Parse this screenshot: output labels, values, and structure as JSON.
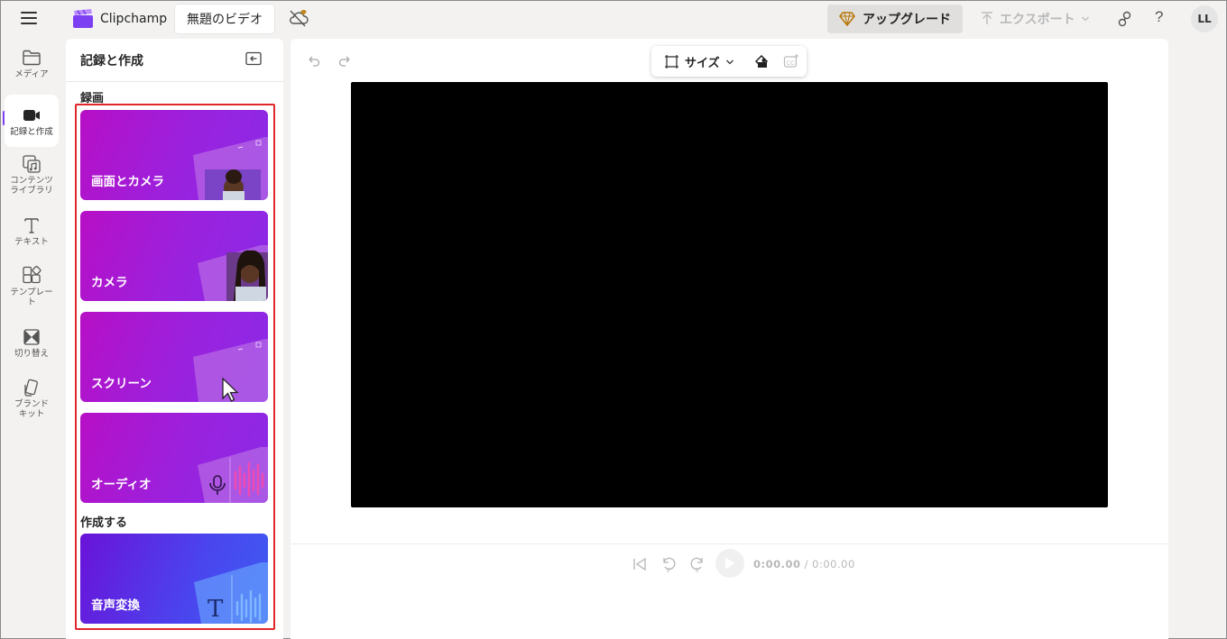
{
  "app": {
    "brand": "Clipchamp",
    "project_title": "無題のビデオ"
  },
  "header": {
    "upgrade_label": "アップグレード",
    "export_label": "エクスポート",
    "help_glyph": "?",
    "avatar_initials": "LL"
  },
  "rail": {
    "items": [
      {
        "label_lines": [
          "メディア"
        ],
        "icon": "folder-icon"
      },
      {
        "label_lines": [
          "記録と作成"
        ],
        "icon": "video-camera-icon",
        "active": true
      },
      {
        "label_lines": [
          "コンテンツ",
          "ライブラリ"
        ],
        "icon": "content-library-icon"
      },
      {
        "label_lines": [
          "テキスト"
        ],
        "icon": "text-icon"
      },
      {
        "label_lines": [
          "テンプレー",
          "ト"
        ],
        "icon": "templates-icon"
      },
      {
        "label_lines": [
          "切り替え"
        ],
        "icon": "transitions-icon"
      },
      {
        "label_lines": [
          "ブランド",
          "キット"
        ],
        "icon": "brand-kit-icon"
      }
    ]
  },
  "panel": {
    "title": "記録と作成",
    "section_record": "録画",
    "section_create": "作成する",
    "cards": {
      "screen_camera": "画面とカメラ",
      "camera": "カメラ",
      "screen": "スクリーン",
      "audio": "オーディオ",
      "tts": "音声変換"
    }
  },
  "editor": {
    "size_label": "サイズ",
    "current_time": "0:00.00",
    "separator": " / ",
    "total_time": "0:00.00",
    "skip_seconds": "5"
  },
  "colors": {
    "accent": "#7d3ff2",
    "highlight_frame": "#e0272b",
    "preview_bg": "#000000"
  }
}
